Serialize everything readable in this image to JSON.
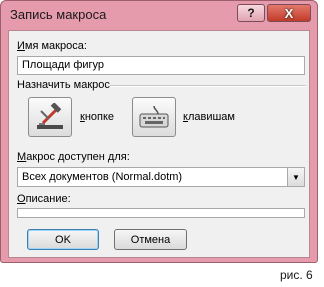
{
  "dialog": {
    "title": "Запись макроса",
    "help_glyph": "?",
    "close_glyph": "X",
    "macro_name_label_first": "И",
    "macro_name_label_rest": "мя макроса:",
    "macro_name_value": "Площади фигур",
    "assign_label": "Назначить макрос",
    "button_label_first": "к",
    "button_label_rest": "нопке",
    "keyboard_label_first": "к",
    "keyboard_label_rest": "лавишам",
    "store_label_first": "М",
    "store_label_rest": "акрос доступен для:",
    "store_value": "Всех документов (Normal.dotm)",
    "description_label_first": "О",
    "description_label_rest": "писание:",
    "description_value": "",
    "ok_label": "OK",
    "cancel_label": "Отмена"
  },
  "caption": "рис. 6",
  "icons": {
    "button_icon": "hammer-wrench-icon",
    "keyboard_icon": "keyboard-icon",
    "dropdown_icon": "dropdown-arrow-icon"
  },
  "colors": {
    "frame": "#e59bab",
    "close": "#c23b29",
    "client": "#f0f0f0"
  }
}
